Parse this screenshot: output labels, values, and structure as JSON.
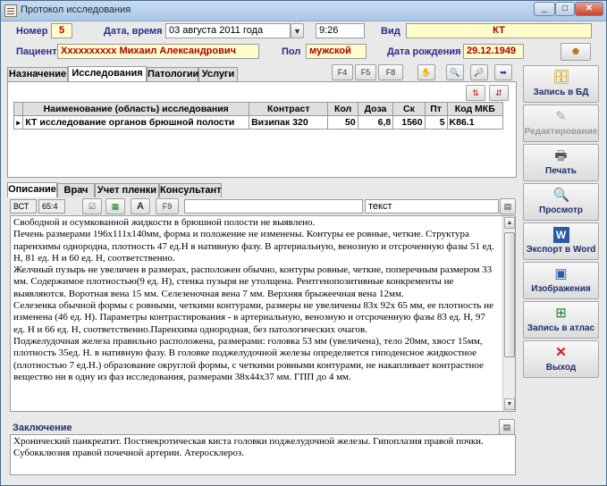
{
  "window": {
    "title": "Протокол исследования"
  },
  "header": {
    "number_label": "Номер",
    "number_value": "5",
    "datetime_label": "Дата, время",
    "date_value": "03 августа 2011 года",
    "time_value": "9:26",
    "type_label": "Вид",
    "type_value": "КТ",
    "patient_label": "Пациент",
    "patient_value": "Хххххххххх Михаил Александрович",
    "sex_label": "Пол",
    "sex_value": "мужской",
    "birth_label": "Дата рождения",
    "birth_value": "29.12.1949"
  },
  "top_tabs": [
    "Назначение",
    "Исследования",
    "Патологии",
    "Услуги"
  ],
  "toolbar": {
    "f4": "F4",
    "f5": "F5",
    "f8": "F8"
  },
  "studies_table": {
    "columns": [
      "Наименование (область) исследования",
      "Контраст",
      "Кол",
      "Доза",
      "Ск",
      "Пт",
      "Код МКБ"
    ],
    "rows": [
      {
        "marker": "►",
        "name": "КТ исследование органов брюшной полости",
        "contrast": "Визипак 320",
        "qty": "50",
        "dose": "6,8",
        "sk": "1560",
        "pt": "5",
        "mkb": "K86.1"
      }
    ]
  },
  "bottom_tabs": [
    "Описание",
    "Врач",
    "Учет пленки",
    "Консультант"
  ],
  "desc_toolbar": {
    "bct": "ВСТ",
    "value": "65:4",
    "a": "А",
    "f9": "F9",
    "text_field": "текст"
  },
  "description": [
    "Свободной и осумкованной жидкости в брюшной полости не выявлено.",
    "Печень размерами 196х111х140мм, форма и положение не изменены. Контуры ее ровные, четкие. Структура паренхимы однородна, плотность 47 ед.Н в нативную фазу. В артериальную, венозную и отсроченную фазы 51 ед. Н, 81 ед. Н и 60 ед. Н, соответственно.",
    "Желчный пузырь не увеличен в размерах, расположен обычно, контуры ровные, четкие, поперечным размером 33 мм. Содержимое плотностью(9 ед. Н), стенка пузыря не утолщена. Рентгенопозитивные конкременты не выявляются. Воротная вена 15 мм. Селезеночная вена 7 мм. Верхняя брыжеечная вена 12мм.",
    "Селезенка обычной формы с ровными, четкими контурами, размеры не увеличены 83х 92х 65 мм, ее плотность не изменена (46 ед. Н). Параметры контрастирования - в артериальную, венозную и отсроченную фазы 83 ед. Н, 97 ед. Н и 66 ед. Н, соответственно.Паренхима однородная, без патологических очагов.",
    " Поджелудочная железа правильно расположена, размерами: головка 53 мм (увеличена), тело 20мм, хвост 15мм, плотность 35ед. Н. в нативную фазу. В головке поджелудочной железы определяется гиподенсное жидкостное (плотностью 7 ед.Н.) образование округлой формы, с четкими ровными контурами, не накапливает контрастное вещество ни в одну из фаз исследования, размерами 38х44х37 мм. ГПП до 4 мм."
  ],
  "conclusion": {
    "label": "Заключение",
    "text": "Хронический панкреатит. Постнекротическая киста головки поджелудочной железы. Гипоплазия правой почки. Субокклюзия правой почечной артерии. Атеросклероз."
  },
  "actions": [
    {
      "label": "Запись в БД",
      "icon": "save-db-icon",
      "enabled": true
    },
    {
      "label": "Редактирование",
      "icon": "edit-icon",
      "enabled": false
    },
    {
      "label": "Печать",
      "icon": "printer-icon",
      "enabled": true
    },
    {
      "label": "Просмотр",
      "icon": "preview-icon",
      "enabled": true
    },
    {
      "label": "Экспорт в Word",
      "icon": "word-icon",
      "enabled": true
    },
    {
      "label": "Изображения",
      "icon": "images-icon",
      "enabled": true
    },
    {
      "label": "Запись в атлас",
      "icon": "atlas-icon",
      "enabled": true
    },
    {
      "label": "Выход",
      "icon": "exit-icon",
      "enabled": true
    }
  ]
}
